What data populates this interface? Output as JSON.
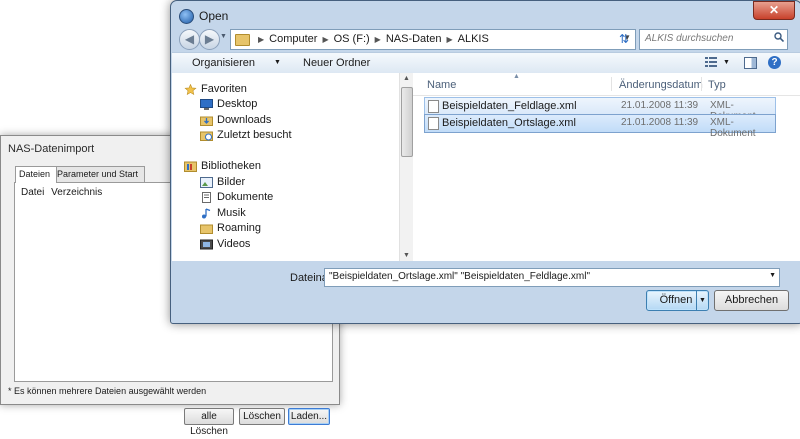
{
  "background_window": {
    "title": "NAS-Datenimport",
    "tabs": [
      "Dateien",
      "Parameter und Start"
    ],
    "columns": [
      "Datei",
      "Verzeichnis"
    ],
    "buttons": {
      "clear_all": "alle Löschen",
      "delete": "Löschen",
      "load": "Laden..."
    },
    "status": "* Es können mehrere Dateien ausgewählt werden"
  },
  "dialog": {
    "title": "Open",
    "close_symbol": "✕",
    "address": {
      "crumbs": [
        "Computer",
        "OS (F:)",
        "NAS-Daten",
        "ALKIS"
      ]
    },
    "search": {
      "placeholder": "ALKIS durchsuchen"
    },
    "toolbar": {
      "organize": "Organisieren",
      "new_folder": "Neuer Ordner",
      "help": "?"
    },
    "nav": {
      "favorites": {
        "label": "Favoriten",
        "items": [
          "Desktop",
          "Downloads",
          "Zuletzt besucht"
        ]
      },
      "libraries": {
        "label": "Bibliotheken",
        "items": [
          "Bilder",
          "Dokumente",
          "Musik",
          "Roaming",
          "Videos"
        ]
      }
    },
    "columns": {
      "name": "Name",
      "date": "Änderungsdatum",
      "type": "Typ"
    },
    "files": [
      {
        "name": "Beispieldaten_Feldlage.xml",
        "date": "21.01.2008 11:39",
        "type": "XML-Dokument"
      },
      {
        "name": "Beispieldaten_Ortslage.xml",
        "date": "21.01.2008 11:39",
        "type": "XML-Dokument"
      }
    ],
    "filename_label": "Dateiname:",
    "filename_value": "\"Beispieldaten_Ortslage.xml\" \"Beispieldaten_Feldlage.xml\"",
    "buttons": {
      "open": "Öffnen",
      "cancel": "Abbrechen"
    }
  },
  "icons": {
    "favorites": "star-icon",
    "desktop": "desktop-icon",
    "downloads": "downloads-folder-icon",
    "recent": "recent-places-icon",
    "libraries": "library-icon",
    "pictures": "pictures-icon",
    "documents": "documents-icon",
    "music": "music-icon",
    "roaming": "roaming-folder-icon",
    "videos": "videos-icon",
    "file": "xml-file-icon"
  },
  "colors": {
    "dialog_frame": "#c4d6ea",
    "selection": "#d9e8f9",
    "close_button": "#c8412b"
  }
}
